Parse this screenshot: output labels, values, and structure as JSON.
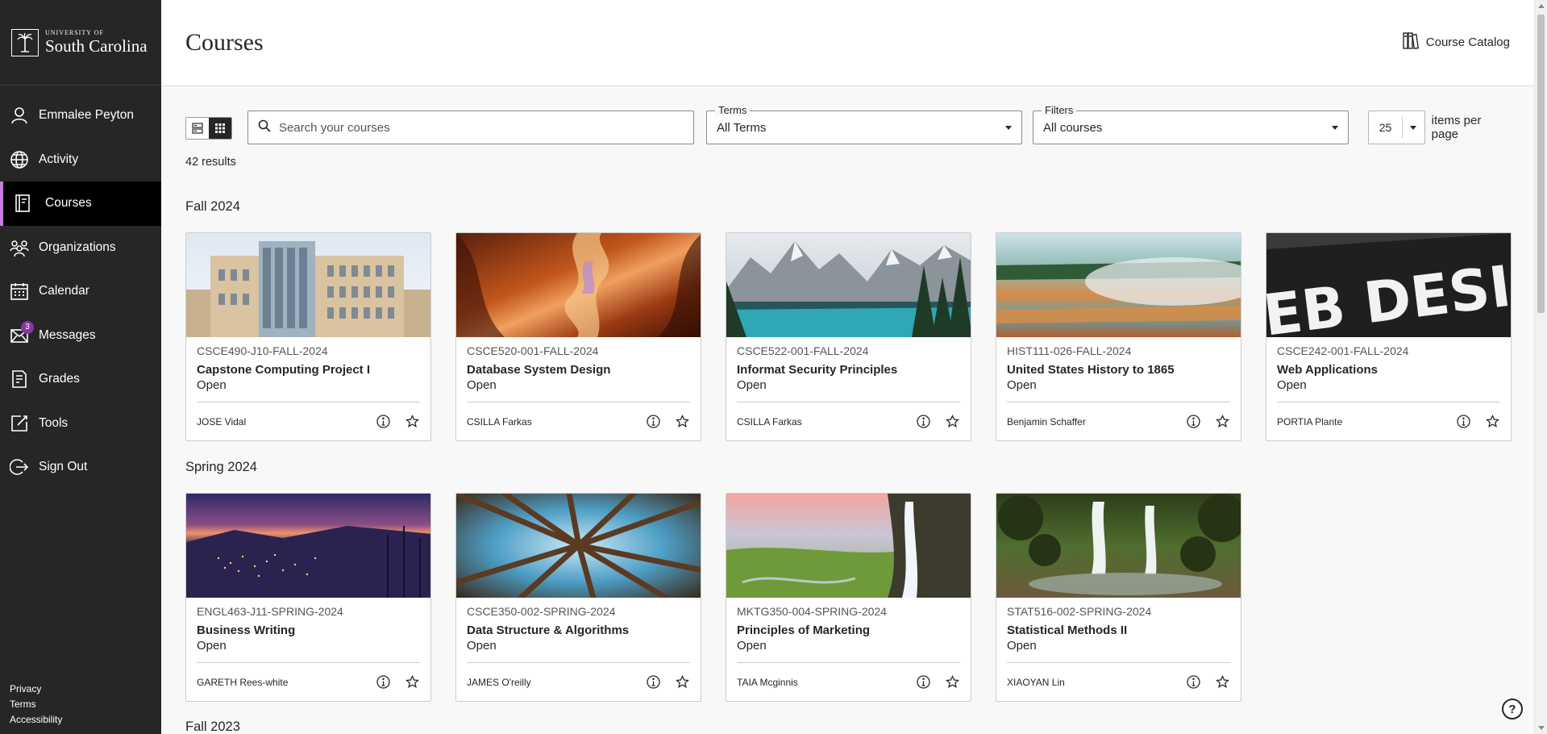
{
  "brand": {
    "small": "UNIVERSITY OF",
    "large": "South Carolina"
  },
  "nav": [
    {
      "label": "Emmalee Peyton",
      "icon": "user-icon"
    },
    {
      "label": "Activity",
      "icon": "globe-icon"
    },
    {
      "label": "Courses",
      "icon": "courses-icon",
      "active": true
    },
    {
      "label": "Organizations",
      "icon": "organizations-icon"
    },
    {
      "label": "Calendar",
      "icon": "calendar-icon"
    },
    {
      "label": "Messages",
      "icon": "mail-icon",
      "badge": "3"
    },
    {
      "label": "Grades",
      "icon": "grades-icon"
    },
    {
      "label": "Tools",
      "icon": "tools-icon"
    },
    {
      "label": "Sign Out",
      "icon": "sign-out-icon"
    }
  ],
  "footer": {
    "privacy": "Privacy",
    "terms": "Terms",
    "accessibility": "Accessibility"
  },
  "header": {
    "title": "Courses",
    "catalog": "Course Catalog"
  },
  "toolbar": {
    "search_placeholder": "Search your courses",
    "terms_label": "Terms",
    "terms_value": "All Terms",
    "filters_label": "Filters",
    "filters_value": "All courses",
    "items_per_page": "25",
    "items_per_page_label": "items per page"
  },
  "results": "42 results",
  "sections": [
    {
      "term": "Fall 2024",
      "courses": [
        {
          "id": "CSCE490-J10-FALL-2024",
          "name": "Capstone Computing Project I",
          "status": "Open",
          "instructor": "JOSE Vidal",
          "image": "building"
        },
        {
          "id": "CSCE520-001-FALL-2024",
          "name": "Database System Design",
          "status": "Open",
          "instructor": "CSILLA Farkas",
          "image": "canyon"
        },
        {
          "id": "CSCE522-001-FALL-2024",
          "name": "Informat Security Principles",
          "status": "Open",
          "instructor": "CSILLA Farkas",
          "image": "lake"
        },
        {
          "id": "HIST111-026-FALL-2024",
          "name": "United States History to 1865",
          "status": "Open",
          "instructor": "Benjamin Schaffer",
          "image": "springs"
        },
        {
          "id": "CSCE242-001-FALL-2024",
          "name": "Web Applications",
          "status": "Open",
          "instructor": "PORTIA Plante",
          "image": "webdesign"
        }
      ]
    },
    {
      "term": "Spring 2024",
      "courses": [
        {
          "id": "ENGL463-J11-SPRING-2024",
          "name": "Business Writing",
          "status": "Open",
          "instructor": "GARETH Rees-white",
          "image": "city-night"
        },
        {
          "id": "CSCE350-002-SPRING-2024",
          "name": "Data Structure & Algorithms",
          "status": "Open",
          "instructor": "JAMES O'reilly",
          "image": "trees"
        },
        {
          "id": "MKTG350-004-SPRING-2024",
          "name": "Principles of Marketing",
          "status": "Open",
          "instructor": "TAIA Mcginnis",
          "image": "waterfall"
        },
        {
          "id": "STAT516-002-SPRING-2024",
          "name": "Statistical Methods II",
          "status": "Open",
          "instructor": "XIAOYAN Lin",
          "image": "forest-falls"
        }
      ]
    },
    {
      "term": "Fall 2023",
      "courses": []
    }
  ],
  "image_text": {
    "webdesign": "EB DESIG"
  },
  "colors": {
    "sidebar": "#262626",
    "active_accent": "#c77dd6",
    "badge": "#8a35a6"
  }
}
